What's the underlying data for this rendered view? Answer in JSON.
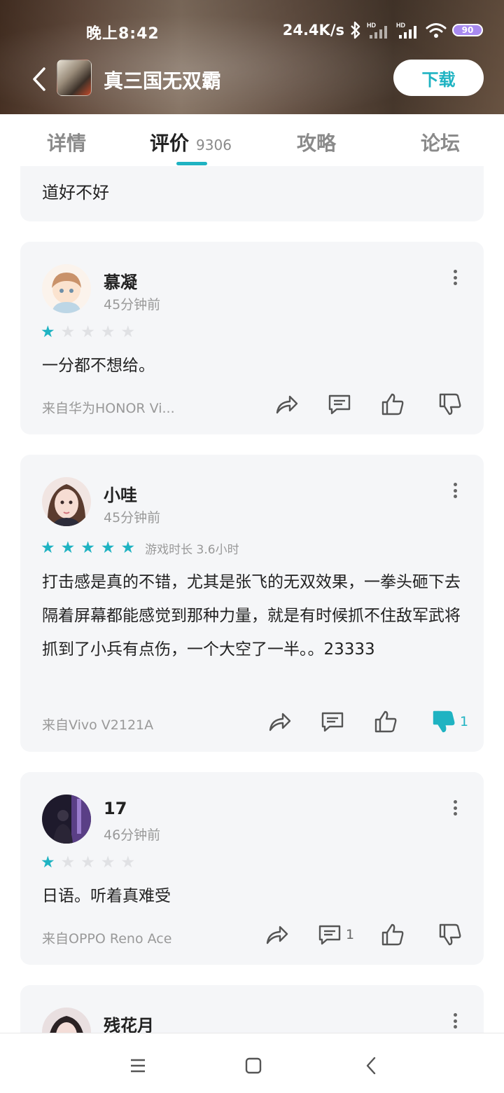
{
  "status_bar": {
    "time": "晚上8:42",
    "net_speed": "24.4K/s",
    "battery": "90"
  },
  "app": {
    "title": "真三国无双霸",
    "download_label": "下载"
  },
  "tabs": [
    {
      "label": "详情"
    },
    {
      "label": "评价",
      "count": "9306"
    },
    {
      "label": "攻略"
    },
    {
      "label": "论坛"
    }
  ],
  "reviews": {
    "partial": {
      "text": "道好不好"
    },
    "items": [
      {
        "user": "慕凝",
        "time": "45分钟前",
        "rating": 1,
        "text": "一分都不想给。",
        "device": "来自华为HONOR Vi...",
        "comment_count": "",
        "dislike_count": ""
      },
      {
        "user": "小哇",
        "time": "45分钟前",
        "rating": 5,
        "playtime": "游戏时长 3.6小时",
        "text": "打击感是真的不错，尤其是张飞的无双效果，一拳头砸下去隔着屏幕都能感觉到那种力量，就是有时候抓不住敌军武将抓到了小兵有点伤，一个大空了一半。。23333",
        "device": "来自Vivo V2121A",
        "comment_count": "",
        "dislike_count": "1"
      },
      {
        "user": "17",
        "time": "46分钟前",
        "rating": 1,
        "text": "日语。听着真难受",
        "device": "来自OPPO Reno Ace",
        "comment_count": "1",
        "dislike_count": ""
      },
      {
        "user": "残花月"
      }
    ]
  },
  "icons": {
    "back": "back-arrow-icon",
    "share": "share-icon",
    "comment": "comment-icon",
    "like": "thumb-up-icon",
    "dislike": "thumb-down-icon",
    "more": "more-vertical-icon",
    "star": "star-icon",
    "bluetooth": "bluetooth-icon",
    "signal": "signal-icon",
    "wifi": "wifi-icon",
    "menu": "menu-icon",
    "home": "home-icon",
    "nav_back": "nav-back-icon"
  },
  "colors": {
    "accent": "#1fb3c2",
    "card_bg": "#f5f6f8",
    "star_off": "#e0e1e4"
  }
}
